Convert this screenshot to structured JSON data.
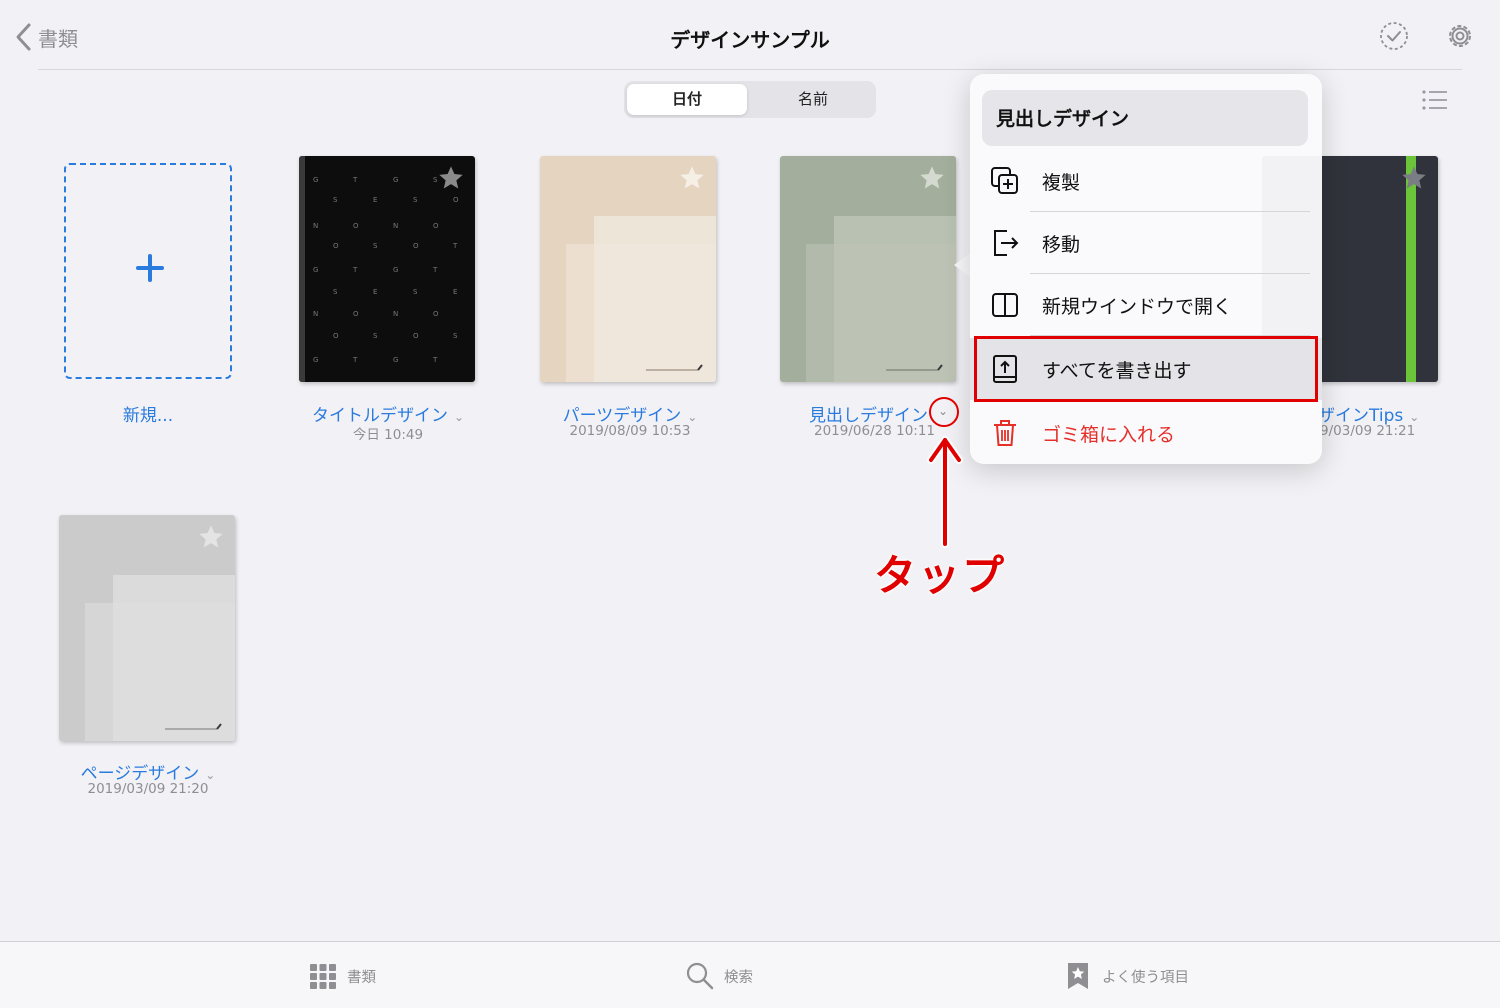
{
  "header": {
    "back_label": "書類",
    "title": "デザインサンプル",
    "select_icon": "checkmark-circle-icon",
    "settings_icon": "gear-icon"
  },
  "sort": {
    "options": [
      "日付",
      "名前"
    ],
    "selected": "日付"
  },
  "new_document": {
    "label": "新規..."
  },
  "documents": [
    {
      "name": "タイトルデザイン",
      "date": "今日 10:49"
    },
    {
      "name": "パーツデザイン",
      "date": "2019/08/09 10:53"
    },
    {
      "name": "見出しデザイン",
      "date": "2019/06/28 10:11"
    },
    {
      "name": "デザインTips",
      "date": "2019/03/09 21:21"
    },
    {
      "name": "ページデザイン",
      "date": "2019/03/09 21:20"
    }
  ],
  "visible_partial": {
    "doc3_name": "見出しデザイン",
    "doc4_name": "ザインTips",
    "doc4_date": "9/03/09 21:21"
  },
  "context_menu": {
    "title": "見出しデザイン",
    "items": [
      {
        "label": "複製",
        "icon": "duplicate-icon"
      },
      {
        "label": "移動",
        "icon": "move-icon"
      },
      {
        "label": "新規ウインドウで開く",
        "icon": "split-window-icon"
      },
      {
        "label": "すべてを書き出す",
        "icon": "export-icon",
        "highlighted": true
      },
      {
        "label": "ゴミ箱に入れる",
        "icon": "trash-icon",
        "destructive": true
      }
    ]
  },
  "annotation": {
    "text": "タップ",
    "color": "#e00000"
  },
  "tabbar": {
    "items": [
      {
        "label": "書類",
        "icon": "grid-icon"
      },
      {
        "label": "検索",
        "icon": "search-icon"
      },
      {
        "label": "よく使う項目",
        "icon": "bookmark-star-icon"
      }
    ]
  },
  "colors": {
    "accent": "#2a7bde",
    "destructive": "#e5302a",
    "highlight_box": "#e00000"
  }
}
